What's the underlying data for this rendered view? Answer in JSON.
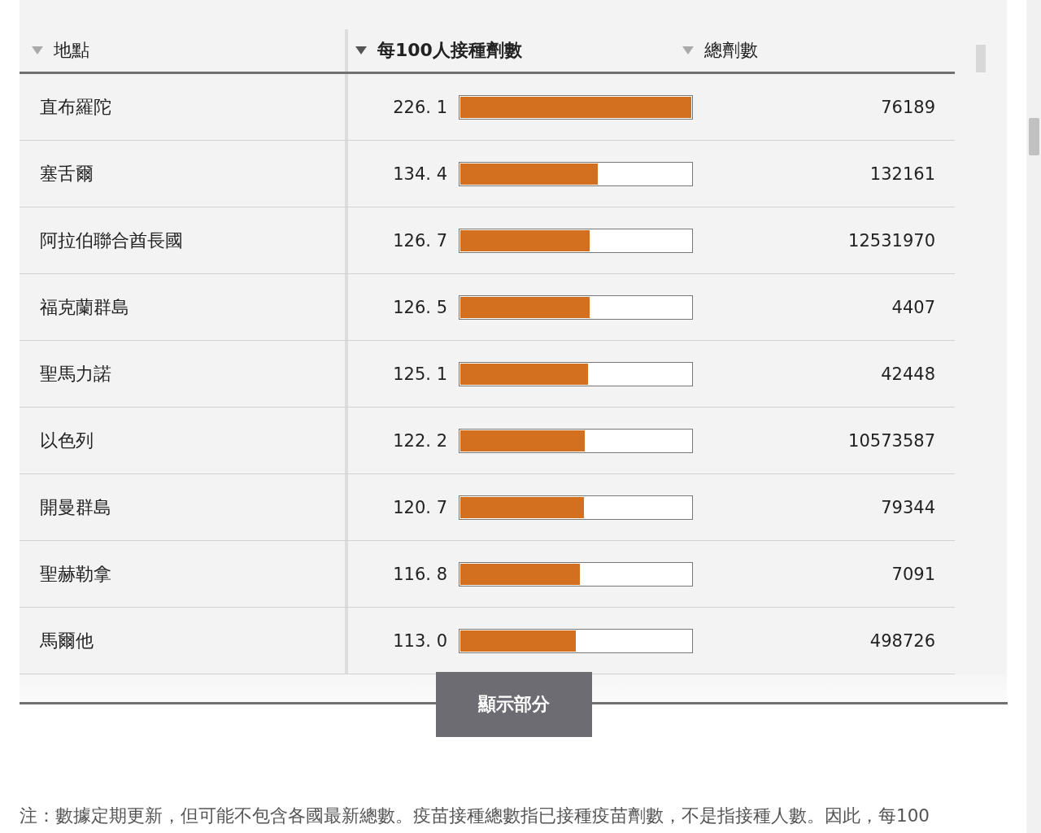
{
  "table": {
    "columns": [
      {
        "label": "地點",
        "selected": false
      },
      {
        "label": "每100人接種劑數",
        "selected": true
      },
      {
        "label": "總劑數",
        "selected": false
      }
    ],
    "rows": [
      {
        "place": "直布羅陀",
        "per100": "226. 1",
        "level": 1.0,
        "total": "76189"
      },
      {
        "place": "塞舌爾",
        "per100": "134. 4",
        "level": 0.594,
        "total": "132161"
      },
      {
        "place": "阿拉伯聯合酋長國",
        "per100": "126. 7",
        "level": 0.56,
        "total": "12531970"
      },
      {
        "place": "福克蘭群島",
        "per100": "126. 5",
        "level": 0.559,
        "total": "4407"
      },
      {
        "place": "聖馬力諾",
        "per100": "125. 1",
        "level": 0.553,
        "total": "42448"
      },
      {
        "place": "以色列",
        "per100": "122. 2",
        "level": 0.54,
        "total": "10573587"
      },
      {
        "place": "開曼群島",
        "per100": "120. 7",
        "level": 0.534,
        "total": "79344"
      },
      {
        "place": "聖赫勒拿",
        "per100": "116. 8",
        "level": 0.517,
        "total": "7091"
      },
      {
        "place": "馬爾他",
        "per100": "113. 0",
        "level": 0.5,
        "total": "498726"
      }
    ]
  },
  "toggle_button": "顯示部分",
  "note": "注：數據定期更新，但可能不包含各國最新總數。疫苗接種總數指已接種疫苗劑數，不是指接種人數。因此，每100"
}
